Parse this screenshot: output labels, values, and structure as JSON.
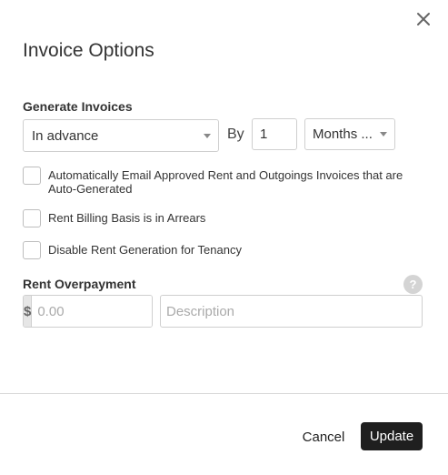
{
  "dialog": {
    "title": "Invoice Options",
    "close_icon": "close-icon"
  },
  "generate_invoices": {
    "label": "Generate Invoices",
    "timing_value": "In advance",
    "by_label": "By",
    "period_count": "1",
    "period_unit": "Months ..."
  },
  "options": {
    "auto_email_label": "Automatically Email Approved Rent and Outgoings Invoices that are Auto-Generated",
    "auto_email_checked": false,
    "arrears_label": "Rent Billing Basis is in Arrears",
    "arrears_checked": false,
    "disable_rent_label": "Disable Rent Generation for Tenancy",
    "disable_rent_checked": false
  },
  "rent_overpayment": {
    "label": "Rent Overpayment",
    "help_icon": "question-icon",
    "help_glyph": "?",
    "currency_symbol": "$",
    "amount_placeholder": "0.00",
    "description_placeholder": "Description"
  },
  "footer": {
    "cancel_label": "Cancel",
    "update_label": "Update"
  }
}
